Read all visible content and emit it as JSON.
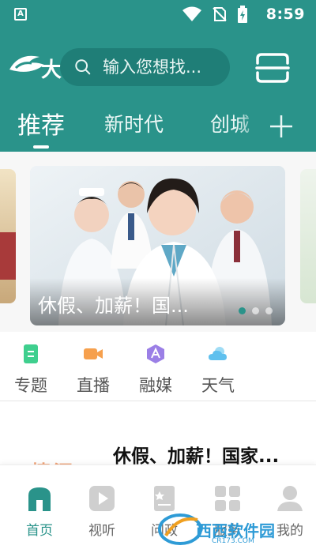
{
  "status_bar": {
    "time": "8:59",
    "left_icon_letter": "A"
  },
  "header": {
    "logo_char": "大",
    "search": {
      "placeholder": "输入您想找..."
    },
    "scan_icon": "scan-icon"
  },
  "tabs": {
    "items": [
      {
        "label": "推荐",
        "active": true
      },
      {
        "label": "新时代",
        "active": false
      },
      {
        "label": "创城",
        "active": false
      }
    ],
    "add_icon": "plus-icon"
  },
  "banner": {
    "caption": "休假、加薪！国...",
    "dots": 3,
    "active_dot": 0
  },
  "quick_entries": [
    {
      "label": "专题",
      "icon": "document-icon",
      "color": "#3fcf8e"
    },
    {
      "label": "直播",
      "icon": "video-camera-icon",
      "color": "#f6a04d"
    },
    {
      "label": "融媒",
      "icon": "badge-icon",
      "color": "#9b7fe6"
    },
    {
      "label": "天气",
      "icon": "cloud-icon",
      "color": "#5fc0ee"
    }
  ],
  "news": {
    "title": "休假、加薪！国家...",
    "thumb_text": "情深"
  },
  "bottom_nav": [
    {
      "label": "首页",
      "icon": "home-icon",
      "active": true
    },
    {
      "label": "视听",
      "icon": "play-icon",
      "active": false
    },
    {
      "label": "问政",
      "icon": "question-list-icon",
      "active": false
    },
    {
      "label": "服务",
      "icon": "grid-icon",
      "active": false
    },
    {
      "label": "我的",
      "icon": "user-icon",
      "active": false
    }
  ],
  "watermark": {
    "text": "西西软件园",
    "sub": "CR173.COM"
  },
  "colors": {
    "brand": "#2a938a",
    "brand_dark": "#1f7e77",
    "accent_dot": "#2a938a"
  }
}
